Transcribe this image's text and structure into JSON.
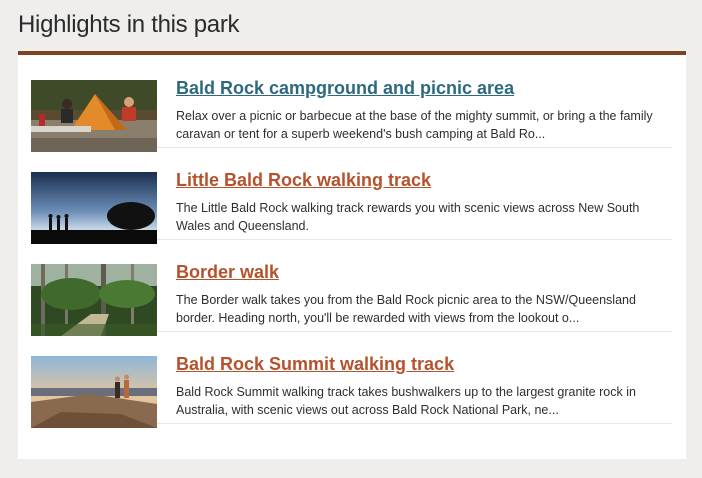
{
  "section": {
    "heading": "Highlights in this park"
  },
  "items": [
    {
      "title": "Bald Rock campground and picnic area",
      "title_color": "#2d6a80",
      "description": "Relax over a picnic or barbecue at the base of the mighty summit, or bring a the family caravan or tent for a superb weekend's bush camping at Bald Ro..."
    },
    {
      "title": "Little Bald Rock walking track",
      "title_color": "#b5522d",
      "description": "The Little Bald Rock walking track rewards you with scenic views across New South Wales and Queensland."
    },
    {
      "title": "Border walk",
      "title_color": "#b5522d",
      "description": "The Border walk takes you from the Bald Rock picnic area to the NSW/Queensland border. Heading north, you'll be rewarded with views from the lookout o..."
    },
    {
      "title": "Bald Rock Summit walking track",
      "title_color": "#b5522d",
      "description": "Bald Rock Summit walking track takes bushwalkers up to the largest granite rock in Australia, with scenic views out across Bald Rock National Park, ne..."
    }
  ]
}
